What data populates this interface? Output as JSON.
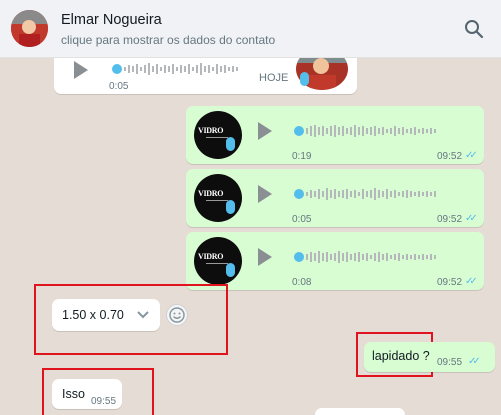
{
  "header": {
    "contact_name": "Elmar Nogueira",
    "subtitle": "clique para mostrar os dados do contato"
  },
  "messages": {
    "top_voice": {
      "duration": "0:05",
      "time": "HOJE"
    },
    "voice1": {
      "duration": "0:19",
      "time": "09:52"
    },
    "voice2": {
      "duration": "0:05",
      "time": "09:52"
    },
    "voice3": {
      "duration": "0:08",
      "time": "09:52"
    },
    "dropdown_msg": {
      "text": "1.50 x 0.70"
    },
    "lapidado": {
      "text": "lapidado ?",
      "time": "09:55"
    },
    "isso": {
      "text": "Isso",
      "time": "09:55"
    }
  },
  "voice_avatar": {
    "brand": "VIDRO"
  },
  "colors": {
    "header_bg": "#f0f2f5",
    "chat_bg": "#e5ddd5",
    "outgoing_bubble": "#d9fdd3",
    "incoming_bubble": "#ffffff",
    "read_ticks": "#53bdeb",
    "highlight_box": "#e0141e"
  }
}
